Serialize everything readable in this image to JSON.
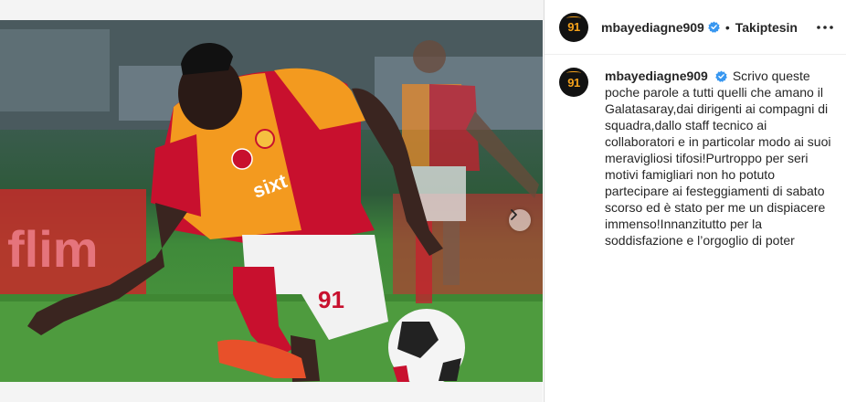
{
  "post": {
    "username": "mbayediagne909",
    "follow_label": "Takiptesin",
    "separator": "•",
    "avatar_text": "91",
    "caption": "Scrivo queste poche parole a tutti quelli che amano il Galatasaray,dai dirigenti ai compagni di squadra,dallo staff tecnico ai collaboratori e in particolar modo ai suoi meravigliosi tifosi!Purtroppo per seri motivi famigliari non ho potuto partecipare ai festeggiamenti di sabato scorso ed è stato per me un dispiacere immenso!Innanzitutto per la soddisfazione e l’orgoglio di poter",
    "jersey_number": "91",
    "icons": {
      "verified": "verified-badge-icon",
      "more": "more-options-icon",
      "next": "chevron-right-icon"
    }
  },
  "colors": {
    "verified_blue": "#3897f0",
    "jersey_orange": "#f39a1f",
    "jersey_red": "#c8102e",
    "avatar_gold": "#f5a21b"
  }
}
